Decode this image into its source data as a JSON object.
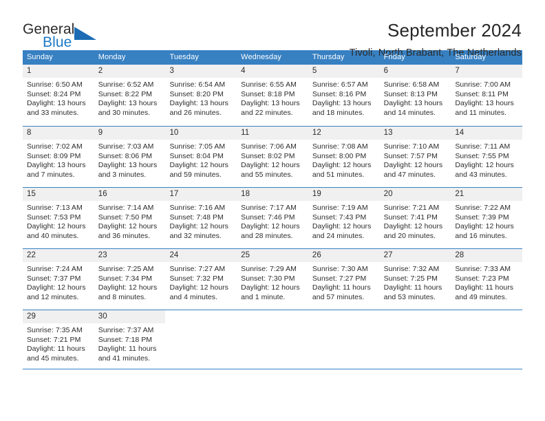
{
  "brand": {
    "name_top": "General",
    "name_bottom": "Blue",
    "mark": "triangle-logo",
    "color_top": "#2b2b2b",
    "color_bottom": "#1b79c6",
    "mark_color": "#1b6cb5"
  },
  "header": {
    "title": "September 2024",
    "subtitle": "Tivoli, North Brabant, The Netherlands"
  },
  "theme": {
    "header_bg": "#3780c2",
    "header_text": "#ffffff",
    "daynum_band": "#f0f0f0",
    "grid_line": "#3780c2",
    "body_text": "#2b2b2b"
  },
  "weekday_headers": [
    "Sunday",
    "Monday",
    "Tuesday",
    "Wednesday",
    "Thursday",
    "Friday",
    "Saturday"
  ],
  "weeks": [
    [
      {
        "day": "1",
        "sunrise": "Sunrise: 6:50 AM",
        "sunset": "Sunset: 8:24 PM",
        "daylight1": "Daylight: 13 hours",
        "daylight2": "and 33 minutes."
      },
      {
        "day": "2",
        "sunrise": "Sunrise: 6:52 AM",
        "sunset": "Sunset: 8:22 PM",
        "daylight1": "Daylight: 13 hours",
        "daylight2": "and 30 minutes."
      },
      {
        "day": "3",
        "sunrise": "Sunrise: 6:54 AM",
        "sunset": "Sunset: 8:20 PM",
        "daylight1": "Daylight: 13 hours",
        "daylight2": "and 26 minutes."
      },
      {
        "day": "4",
        "sunrise": "Sunrise: 6:55 AM",
        "sunset": "Sunset: 8:18 PM",
        "daylight1": "Daylight: 13 hours",
        "daylight2": "and 22 minutes."
      },
      {
        "day": "5",
        "sunrise": "Sunrise: 6:57 AM",
        "sunset": "Sunset: 8:16 PM",
        "daylight1": "Daylight: 13 hours",
        "daylight2": "and 18 minutes."
      },
      {
        "day": "6",
        "sunrise": "Sunrise: 6:58 AM",
        "sunset": "Sunset: 8:13 PM",
        "daylight1": "Daylight: 13 hours",
        "daylight2": "and 14 minutes."
      },
      {
        "day": "7",
        "sunrise": "Sunrise: 7:00 AM",
        "sunset": "Sunset: 8:11 PM",
        "daylight1": "Daylight: 13 hours",
        "daylight2": "and 11 minutes."
      }
    ],
    [
      {
        "day": "8",
        "sunrise": "Sunrise: 7:02 AM",
        "sunset": "Sunset: 8:09 PM",
        "daylight1": "Daylight: 13 hours",
        "daylight2": "and 7 minutes."
      },
      {
        "day": "9",
        "sunrise": "Sunrise: 7:03 AM",
        "sunset": "Sunset: 8:06 PM",
        "daylight1": "Daylight: 13 hours",
        "daylight2": "and 3 minutes."
      },
      {
        "day": "10",
        "sunrise": "Sunrise: 7:05 AM",
        "sunset": "Sunset: 8:04 PM",
        "daylight1": "Daylight: 12 hours",
        "daylight2": "and 59 minutes."
      },
      {
        "day": "11",
        "sunrise": "Sunrise: 7:06 AM",
        "sunset": "Sunset: 8:02 PM",
        "daylight1": "Daylight: 12 hours",
        "daylight2": "and 55 minutes."
      },
      {
        "day": "12",
        "sunrise": "Sunrise: 7:08 AM",
        "sunset": "Sunset: 8:00 PM",
        "daylight1": "Daylight: 12 hours",
        "daylight2": "and 51 minutes."
      },
      {
        "day": "13",
        "sunrise": "Sunrise: 7:10 AM",
        "sunset": "Sunset: 7:57 PM",
        "daylight1": "Daylight: 12 hours",
        "daylight2": "and 47 minutes."
      },
      {
        "day": "14",
        "sunrise": "Sunrise: 7:11 AM",
        "sunset": "Sunset: 7:55 PM",
        "daylight1": "Daylight: 12 hours",
        "daylight2": "and 43 minutes."
      }
    ],
    [
      {
        "day": "15",
        "sunrise": "Sunrise: 7:13 AM",
        "sunset": "Sunset: 7:53 PM",
        "daylight1": "Daylight: 12 hours",
        "daylight2": "and 40 minutes."
      },
      {
        "day": "16",
        "sunrise": "Sunrise: 7:14 AM",
        "sunset": "Sunset: 7:50 PM",
        "daylight1": "Daylight: 12 hours",
        "daylight2": "and 36 minutes."
      },
      {
        "day": "17",
        "sunrise": "Sunrise: 7:16 AM",
        "sunset": "Sunset: 7:48 PM",
        "daylight1": "Daylight: 12 hours",
        "daylight2": "and 32 minutes."
      },
      {
        "day": "18",
        "sunrise": "Sunrise: 7:17 AM",
        "sunset": "Sunset: 7:46 PM",
        "daylight1": "Daylight: 12 hours",
        "daylight2": "and 28 minutes."
      },
      {
        "day": "19",
        "sunrise": "Sunrise: 7:19 AM",
        "sunset": "Sunset: 7:43 PM",
        "daylight1": "Daylight: 12 hours",
        "daylight2": "and 24 minutes."
      },
      {
        "day": "20",
        "sunrise": "Sunrise: 7:21 AM",
        "sunset": "Sunset: 7:41 PM",
        "daylight1": "Daylight: 12 hours",
        "daylight2": "and 20 minutes."
      },
      {
        "day": "21",
        "sunrise": "Sunrise: 7:22 AM",
        "sunset": "Sunset: 7:39 PM",
        "daylight1": "Daylight: 12 hours",
        "daylight2": "and 16 minutes."
      }
    ],
    [
      {
        "day": "22",
        "sunrise": "Sunrise: 7:24 AM",
        "sunset": "Sunset: 7:37 PM",
        "daylight1": "Daylight: 12 hours",
        "daylight2": "and 12 minutes."
      },
      {
        "day": "23",
        "sunrise": "Sunrise: 7:25 AM",
        "sunset": "Sunset: 7:34 PM",
        "daylight1": "Daylight: 12 hours",
        "daylight2": "and 8 minutes."
      },
      {
        "day": "24",
        "sunrise": "Sunrise: 7:27 AM",
        "sunset": "Sunset: 7:32 PM",
        "daylight1": "Daylight: 12 hours",
        "daylight2": "and 4 minutes."
      },
      {
        "day": "25",
        "sunrise": "Sunrise: 7:29 AM",
        "sunset": "Sunset: 7:30 PM",
        "daylight1": "Daylight: 12 hours",
        "daylight2": "and 1 minute."
      },
      {
        "day": "26",
        "sunrise": "Sunrise: 7:30 AM",
        "sunset": "Sunset: 7:27 PM",
        "daylight1": "Daylight: 11 hours",
        "daylight2": "and 57 minutes."
      },
      {
        "day": "27",
        "sunrise": "Sunrise: 7:32 AM",
        "sunset": "Sunset: 7:25 PM",
        "daylight1": "Daylight: 11 hours",
        "daylight2": "and 53 minutes."
      },
      {
        "day": "28",
        "sunrise": "Sunrise: 7:33 AM",
        "sunset": "Sunset: 7:23 PM",
        "daylight1": "Daylight: 11 hours",
        "daylight2": "and 49 minutes."
      }
    ],
    [
      {
        "day": "29",
        "sunrise": "Sunrise: 7:35 AM",
        "sunset": "Sunset: 7:21 PM",
        "daylight1": "Daylight: 11 hours",
        "daylight2": "and 45 minutes."
      },
      {
        "day": "30",
        "sunrise": "Sunrise: 7:37 AM",
        "sunset": "Sunset: 7:18 PM",
        "daylight1": "Daylight: 11 hours",
        "daylight2": "and 41 minutes."
      },
      {
        "day": "",
        "sunrise": "",
        "sunset": "",
        "daylight1": "",
        "daylight2": ""
      },
      {
        "day": "",
        "sunrise": "",
        "sunset": "",
        "daylight1": "",
        "daylight2": ""
      },
      {
        "day": "",
        "sunrise": "",
        "sunset": "",
        "daylight1": "",
        "daylight2": ""
      },
      {
        "day": "",
        "sunrise": "",
        "sunset": "",
        "daylight1": "",
        "daylight2": ""
      },
      {
        "day": "",
        "sunrise": "",
        "sunset": "",
        "daylight1": "",
        "daylight2": ""
      }
    ]
  ]
}
